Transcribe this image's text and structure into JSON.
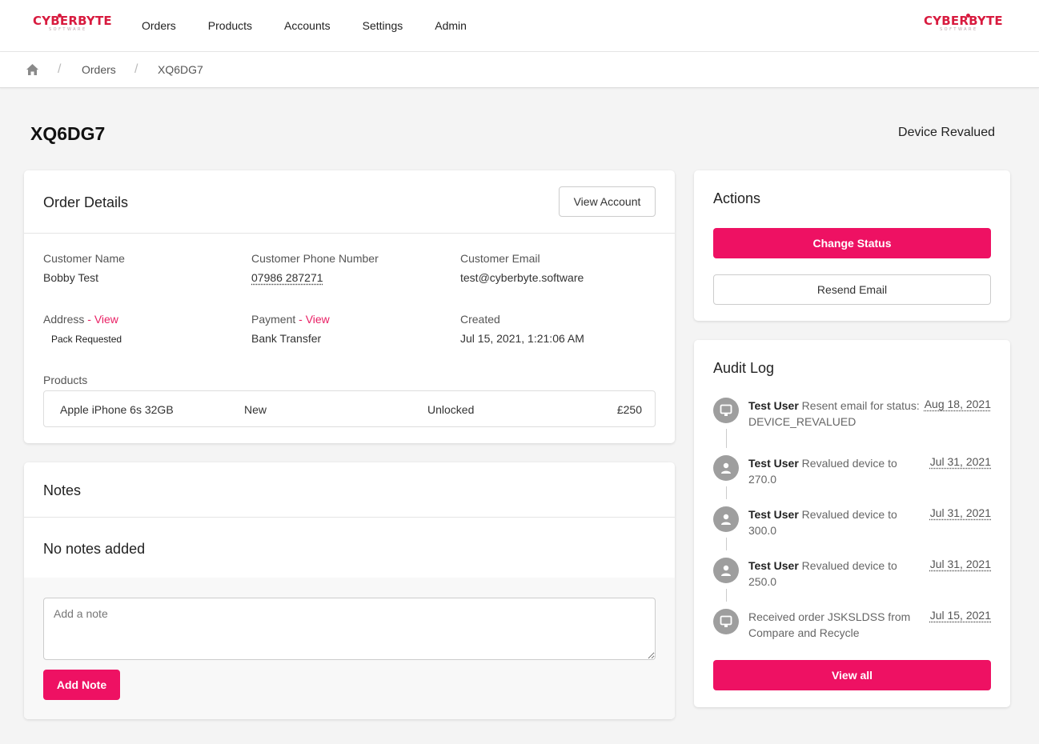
{
  "brand": {
    "name": "CYBERBYTE",
    "tagline": "SOFTWARE",
    "accent": "#ee1163"
  },
  "nav": {
    "items": [
      "Orders",
      "Products",
      "Accounts",
      "Settings",
      "Admin"
    ]
  },
  "breadcrumb": {
    "items": [
      "Orders",
      "XQ6DG7"
    ],
    "separator": "/"
  },
  "page": {
    "title": "XQ6DG7",
    "status": "Device Revalued"
  },
  "order_details": {
    "title": "Order Details",
    "view_account_label": "View Account",
    "customer_name_label": "Customer Name",
    "customer_name": "Bobby Test",
    "phone_label": "Customer Phone Number",
    "phone": "07986 287271",
    "email_label": "Customer Email",
    "email": "test@cyberbyte.software",
    "address_label": "Address",
    "address_link": "View",
    "address_value": "Pack Requested",
    "payment_label": "Payment",
    "payment_link": "View",
    "payment_value": "Bank Transfer",
    "created_label": "Created",
    "created_value": "Jul 15, 2021, 1:21:06 AM",
    "products_label": "Products",
    "products": [
      {
        "name": "Apple iPhone 6s 32GB",
        "condition": "New",
        "network": "Unlocked",
        "price": "£250"
      }
    ]
  },
  "notes": {
    "title": "Notes",
    "empty_text": "No notes added",
    "placeholder": "Add a note",
    "add_label": "Add Note"
  },
  "actions": {
    "title": "Actions",
    "change_status_label": "Change Status",
    "resend_email_label": "Resend Email"
  },
  "audit_log": {
    "title": "Audit Log",
    "entries": [
      {
        "icon": "monitor-icon",
        "user": "Test User",
        "text": "Resent email for status: DEVICE_REVALUED",
        "date": "Aug 18, 2021"
      },
      {
        "icon": "user-icon",
        "user": "Test User",
        "text": "Revalued device to 270.0",
        "date": "Jul 31, 2021"
      },
      {
        "icon": "user-icon",
        "user": "Test User",
        "text": "Revalued device to 300.0",
        "date": "Jul 31, 2021"
      },
      {
        "icon": "user-icon",
        "user": "Test User",
        "text": "Revalued device to 250.0",
        "date": "Jul 31, 2021"
      },
      {
        "icon": "monitor-icon",
        "user": "",
        "text": "Received order JSKSLDSS from Compare and Recycle",
        "date": "Jul 15, 2021"
      }
    ],
    "view_all_label": "View all"
  }
}
